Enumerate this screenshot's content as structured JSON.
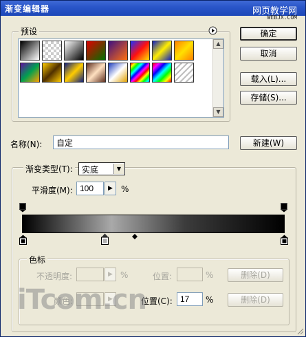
{
  "window": {
    "title": "渐变编辑器"
  },
  "watermark": {
    "top": "网页教学网",
    "top_url": "WEBJX.COM",
    "bottom": "iTcom.cn"
  },
  "buttons": {
    "ok": "确定",
    "cancel": "取消",
    "load": "载入(L)...",
    "save": "存储(S)...",
    "new": "新建(W)",
    "delete_opacity": "删除(D)",
    "delete_color": "删除(D)"
  },
  "presets": {
    "label": "预设"
  },
  "name": {
    "label": "名称(N):",
    "value": "自定"
  },
  "gradient_type": {
    "label": "渐变类型(T):",
    "value": "实底"
  },
  "smoothness": {
    "label": "平滑度(M):",
    "value": "100",
    "unit": "%"
  },
  "color_stops": {
    "group_label": "色标",
    "opacity_label": "不透明度:",
    "opacity_unit": "%",
    "opacity_location_label": "位置:",
    "opacity_location_unit": "%",
    "color_label": "颜色:",
    "color_location_label": "位置(C):",
    "color_location_value": "17",
    "color_location_unit": "%"
  },
  "colors": {
    "title_bar": "#2a56c9",
    "dialog_bg": "#ece9d8"
  }
}
